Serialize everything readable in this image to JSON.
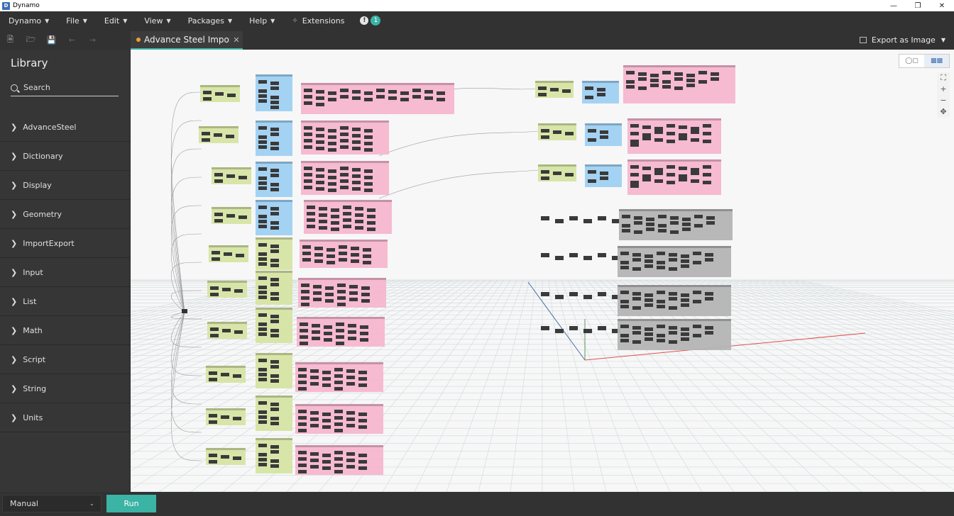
{
  "window": {
    "title": "Dynamo",
    "app_icon": "dynamo-logo-icon"
  },
  "menu": {
    "items": [
      {
        "label": "Dynamo"
      },
      {
        "label": "File"
      },
      {
        "label": "Edit"
      },
      {
        "label": "View"
      },
      {
        "label": "Packages"
      },
      {
        "label": "Help"
      }
    ],
    "extensions_label": "Extensions",
    "notification_count": "1"
  },
  "toolbar": {
    "icons": [
      "new-file-icon",
      "open-file-icon",
      "save-icon",
      "undo-icon",
      "redo-icon"
    ]
  },
  "tab": {
    "label": "Advance Steel Impor...",
    "modified": true
  },
  "export": {
    "label": "Export as Image"
  },
  "library": {
    "title": "Library",
    "search_placeholder": "Search",
    "categories": [
      "AdvanceSteel",
      "Dictionary",
      "Display",
      "Geometry",
      "ImportExport",
      "Input",
      "List",
      "Math",
      "Script",
      "String",
      "Units"
    ]
  },
  "run": {
    "mode": "Manual",
    "button_label": "Run"
  },
  "colors": {
    "accent": "#3bb3a5",
    "group_green": "#d6e4a4",
    "group_blue": "#9fd0f2",
    "group_pink": "#f6b6cf",
    "group_gray": "#b4b4b4",
    "modified_dot": "#f0a030"
  }
}
